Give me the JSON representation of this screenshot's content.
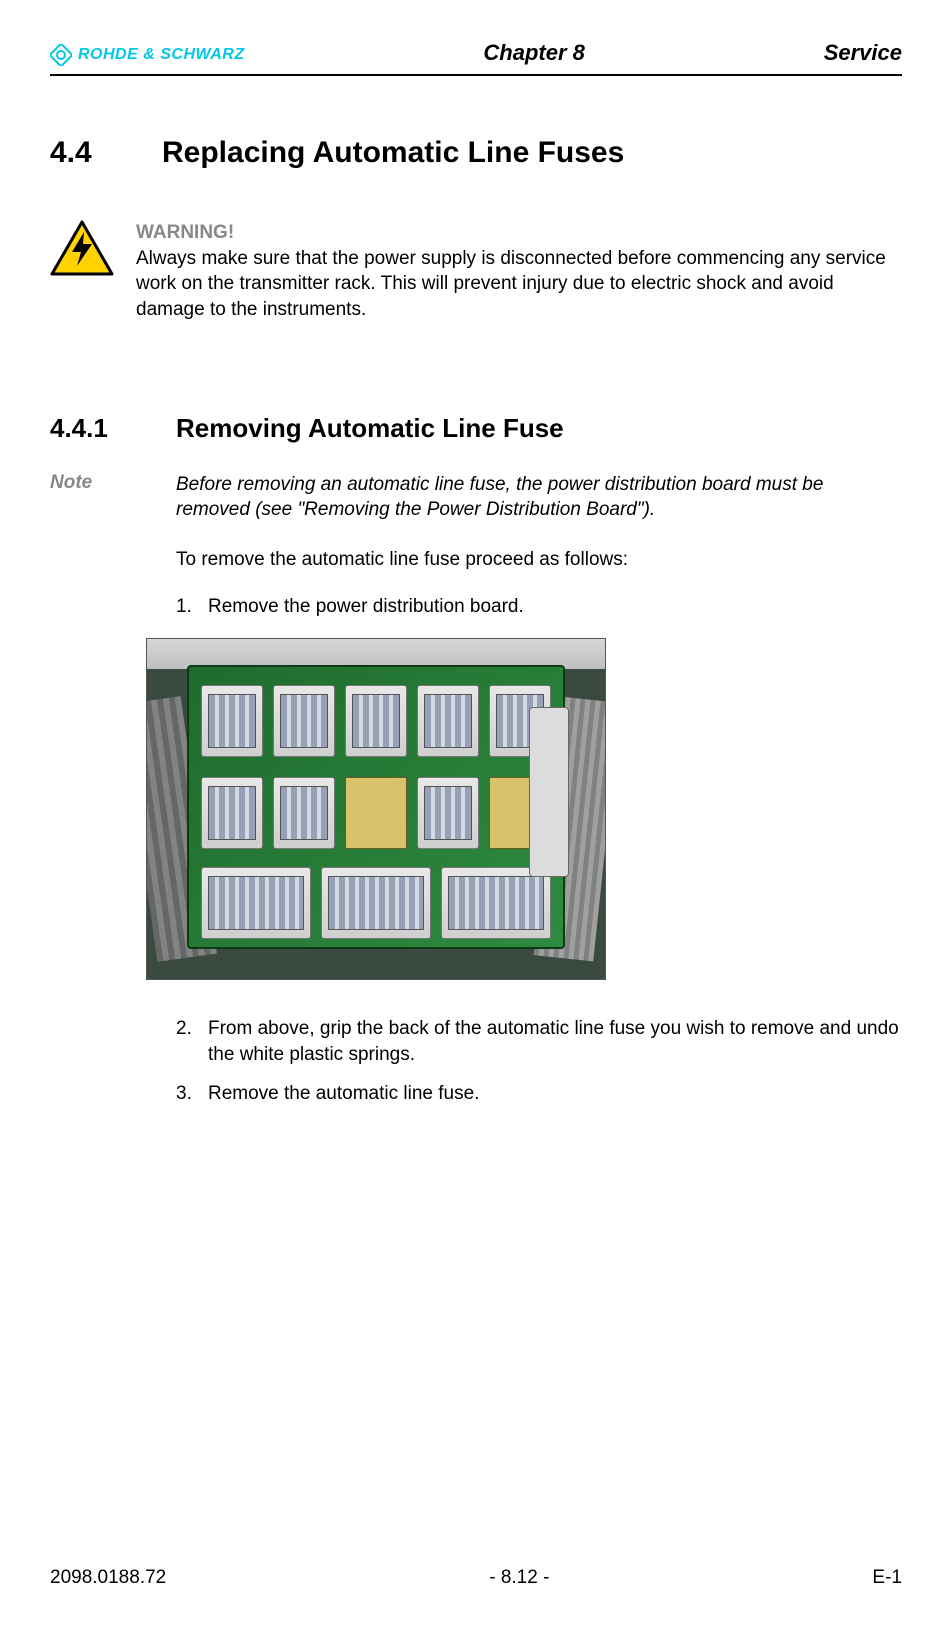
{
  "header": {
    "brand": "ROHDE & SCHWARZ",
    "chapter": "Chapter 8",
    "section_label": "Service"
  },
  "section_4_4": {
    "number": "4.4",
    "title": "Replacing Automatic Line Fuses"
  },
  "warning": {
    "title": "WARNING!",
    "body": "Always make sure that the power supply is disconnected before commencing any service work on the transmitter rack. This will prevent injury due to electric shock and avoid damage to the instruments."
  },
  "section_4_4_1": {
    "number": "4.4.1",
    "title": "Removing Automatic Line Fuse"
  },
  "note": {
    "label": "Note",
    "body": "Before removing an automatic line fuse, the power distribution board must be removed (see \"Removing the Power Distribution Board\")."
  },
  "intro": "To remove the automatic line fuse proceed as follows:",
  "steps": {
    "s1_num": "1.",
    "s1_text": "Remove the power distribution board.",
    "s2_num": "2.",
    "s2_text": "From above, grip the back of the automatic line fuse you wish to remove and undo the white plastic springs.",
    "s3_num": "3.",
    "s3_text": "Remove the automatic line fuse."
  },
  "footer": {
    "doc_id": "2098.0188.72",
    "page": "- 8.12 -",
    "rev": "E-1"
  }
}
